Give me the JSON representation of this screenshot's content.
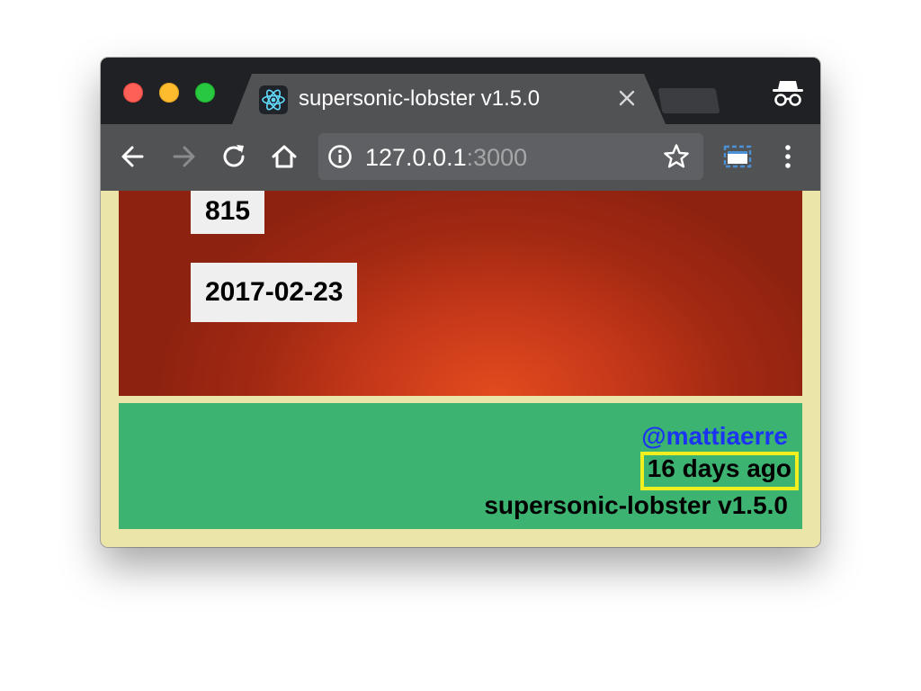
{
  "window": {
    "tab_title": "supersonic-lobster v1.5.0",
    "tab_favicon": "react-atom-icon",
    "incognito_icon": "incognito-icon"
  },
  "toolbar": {
    "back_icon": "back-arrow-icon",
    "forward_icon": "forward-arrow-icon",
    "reload_icon": "reload-icon",
    "home_icon": "home-icon",
    "url_host": "127.0.0.1",
    "url_port": ":3000",
    "info_icon": "info-icon",
    "bookmark_icon": "star-icon",
    "cast_icon": "tab-media-icon",
    "menu_icon": "kebab-menu-icon"
  },
  "hero": {
    "count": "815",
    "date": "2017-02-23"
  },
  "footer": {
    "author_handle": "@mattiaerre",
    "relative_time": "16 days ago",
    "version": "supersonic-lobster v1.5.0"
  },
  "colors": {
    "titlebar": "#202124",
    "toolbar": "#515254",
    "page_border": "#ece5a9",
    "hero_red": "#c8391a",
    "footer_green": "#3db371",
    "link_blue": "#1b33f2",
    "highlight_yellow": "#f2ef20"
  }
}
